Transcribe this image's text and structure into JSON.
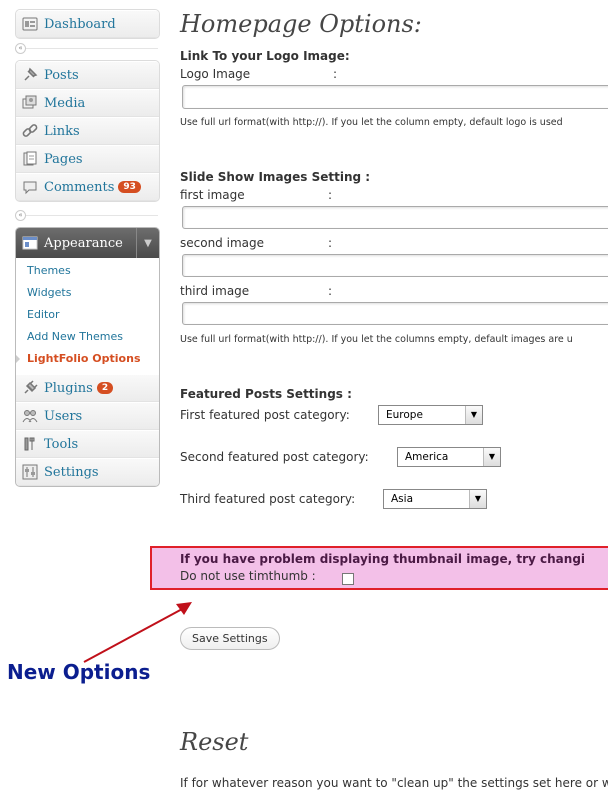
{
  "sidebar": {
    "top_group": [
      {
        "label": "Dashboard",
        "icon": "dashboard-icon"
      }
    ],
    "content_group": [
      {
        "label": "Posts",
        "icon": "pin-icon"
      },
      {
        "label": "Media",
        "icon": "media-icon"
      },
      {
        "label": "Links",
        "icon": "link-icon"
      },
      {
        "label": "Pages",
        "icon": "pages-icon"
      },
      {
        "label": "Comments",
        "icon": "comments-icon",
        "badge": "93"
      }
    ],
    "appearance": {
      "label": "Appearance",
      "icon": "appearance-icon",
      "submenu": [
        "Themes",
        "Widgets",
        "Editor",
        "Add New Themes",
        "LightFolio Options"
      ]
    },
    "settings_group": [
      {
        "label": "Plugins",
        "icon": "plugins-icon",
        "badge": "2"
      },
      {
        "label": "Users",
        "icon": "users-icon"
      },
      {
        "label": "Tools",
        "icon": "tools-icon"
      },
      {
        "label": "Settings",
        "icon": "settings-icon"
      }
    ]
  },
  "main": {
    "title": "Homepage Options:",
    "logo_section": {
      "title": "Link To your Logo Image:",
      "label": "Logo Image",
      "colon": ":",
      "value": "",
      "hint": "Use full url format(with http://). If you let the column empty, default logo is used"
    },
    "slideshow_section": {
      "title": "Slide Show Images Setting :",
      "fields": [
        {
          "label": "first image",
          "colon": ":",
          "value": ""
        },
        {
          "label": "second image",
          "colon": ":",
          "value": ""
        },
        {
          "label": "third image",
          "colon": ":",
          "value": ""
        }
      ],
      "hint": "Use full url format(with http://). If you let the columns empty, default images are u"
    },
    "featured_section": {
      "title": "Featured Posts Settings :",
      "rows": [
        {
          "label": "First featured post category:",
          "selected": "Europe"
        },
        {
          "label": "Second featured post category:",
          "selected": "America"
        },
        {
          "label": "Third featured post category:",
          "selected": "Asia"
        }
      ]
    },
    "notice": {
      "text": "If you have problem displaying thumbnail image, try changi",
      "checkbox_label": "Do not use timthumb :",
      "checked": false,
      "bg_color": "#f3c0e8",
      "border_color": "#e0202a"
    },
    "save_label": "Save Settings",
    "reset_title": "Reset",
    "reset_text": "If for whatever reason you want to \"clean up\" the settings set here or w"
  },
  "annotation": {
    "text": "New Options",
    "color": "#0b1e8f",
    "arrow_color": "#c0101a"
  },
  "colors": {
    "link": "#21759b",
    "current": "#d54e21",
    "badge": "#d54e21"
  }
}
